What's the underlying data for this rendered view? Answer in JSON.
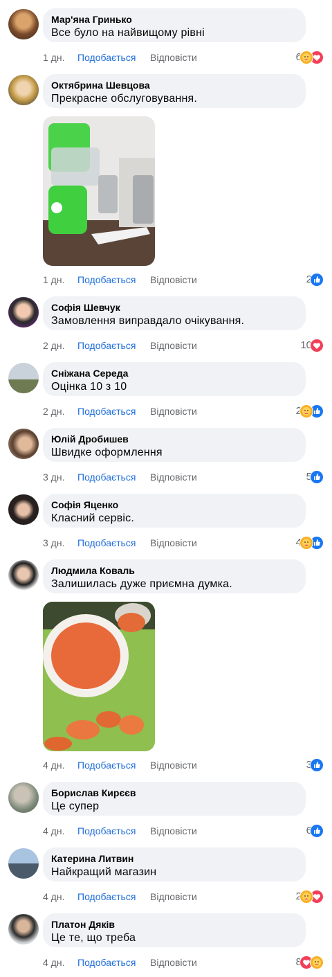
{
  "actions": {
    "like_label": "Подобається",
    "reply_label": "Відповісти"
  },
  "colors": {
    "like_blue": "#1877f2",
    "love_red": "#f33e58",
    "care_yellow": "#f7b125",
    "bubble_bg": "#f0f2f5"
  },
  "comments": [
    {
      "author": "Мар'яна Гринько",
      "text": "Все було на найвищому рівні",
      "time": "1 дн.",
      "reaction_count": "6",
      "reactions": [
        "care",
        "love"
      ]
    },
    {
      "author": "Октябрина Шевцова",
      "text": "Прекрасне обслуговування.",
      "time": "1 дн.",
      "reaction_count": "2",
      "reactions": [
        "like"
      ],
      "photo": "grater-photo"
    },
    {
      "author": "Софія Шевчук",
      "text": "Замовлення виправдало очікування.",
      "time": "2 дн.",
      "reaction_count": "10",
      "reactions": [
        "love"
      ]
    },
    {
      "author": "Сніжана Середа",
      "text": "Оцінка 10 з 10",
      "time": "2 дн.",
      "reaction_count": "2",
      "reactions": [
        "care",
        "like"
      ]
    },
    {
      "author": "Юлій Дробишев",
      "text": "Швидке оформлення",
      "time": "3 дн.",
      "reaction_count": "5",
      "reactions": [
        "like"
      ]
    },
    {
      "author": "Софія Яценко",
      "text": "Класний сервіс.",
      "time": "3 дн.",
      "reaction_count": "4",
      "reactions": [
        "care",
        "like"
      ]
    },
    {
      "author": "Людмила Коваль",
      "text": "Залишилась дуже приємна думка.",
      "time": "4 дн.",
      "reaction_count": "3",
      "reactions": [
        "like"
      ],
      "photo": "carrot-photo"
    },
    {
      "author": "Борислав Кирєєв",
      "text": "Це супер",
      "time": "4 дн.",
      "reaction_count": "6",
      "reactions": [
        "like"
      ]
    },
    {
      "author": "Катерина Литвин",
      "text": "Найкращий магазин",
      "time": "4 дн.",
      "reaction_count": "2",
      "reactions": [
        "care",
        "love"
      ]
    },
    {
      "author": "Платон Дяків",
      "text": "Це те, що треба",
      "time": "4 дн.",
      "reaction_count": "8",
      "reactions": [
        "love",
        "care"
      ]
    }
  ]
}
